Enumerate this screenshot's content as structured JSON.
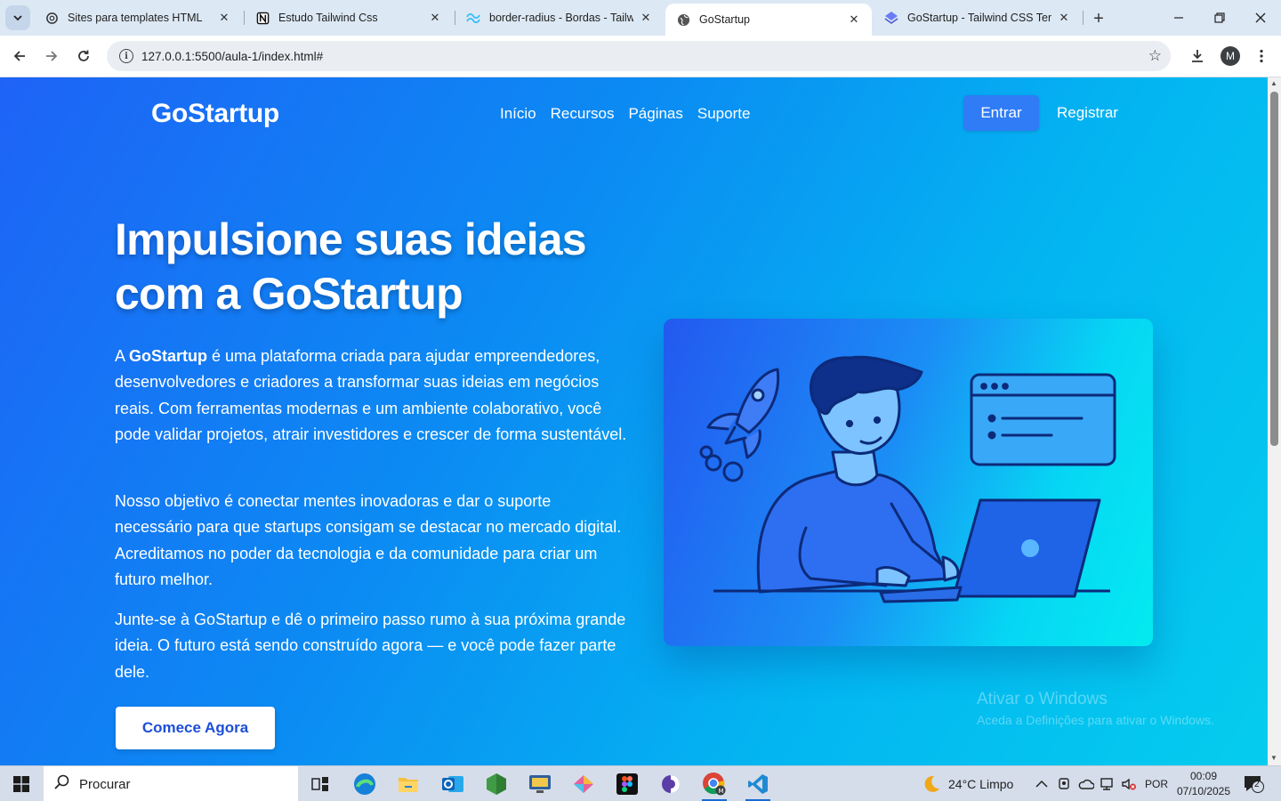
{
  "browser": {
    "tabs": [
      {
        "title": "Sites para templates HTML",
        "icon": "openai-icon",
        "active": false
      },
      {
        "title": "Estudo Tailwind Css",
        "icon": "notion-icon",
        "active": false
      },
      {
        "title": "border-radius - Bordas - Tailwind",
        "icon": "tailwind-icon",
        "active": false
      },
      {
        "title": "GoStartup",
        "icon": "globe-icon",
        "active": true
      },
      {
        "title": "GoStartup - Tailwind CSS Template",
        "icon": "layers-icon",
        "active": false
      }
    ],
    "url": "127.0.0.1:5500/aula-1/index.html#",
    "profile_initial": "M"
  },
  "page": {
    "logo": "GoStartup",
    "nav": [
      "Início",
      "Recursos",
      "Páginas",
      "Suporte"
    ],
    "login_label": "Entrar",
    "register_label": "Registrar",
    "hero_title": "Impulsione suas ideias com a GoStartup",
    "p1_before": "A ",
    "p1_brand": "GoStartup",
    "p1_after": " é uma plataforma criada para ajudar empreendedores, desenvolvedores e criadores a transformar suas ideias em negócios reais. Com ferramentas modernas e um ambiente colaborativo, você pode validar projetos, atrair investidores e crescer de forma sustentável.",
    "p2": "Nosso objetivo é conectar mentes inovadoras e dar o suporte necessário para que startups consigam se destacar no mercado digital. Acreditamos no poder da tecnologia e da comunidade para criar um futuro melhor.",
    "p3": "Junte-se à GoStartup e dê o primeiro passo rumo à sua próxima grande ideia. O futuro está sendo construído agora — e você pode fazer parte dele.",
    "cta_label": "Comece Agora"
  },
  "watermark": {
    "line1": "Ativar o Windows",
    "line2": "Aceda a Definições para ativar o Windows."
  },
  "taskbar": {
    "search_placeholder": "Procurar",
    "weather": "24°C  Limpo",
    "language": "POR",
    "time": "00:09",
    "date": "07/10/2025",
    "notifications": "2"
  },
  "colors": {
    "hero_gradient_start": "#1e63f6",
    "hero_gradient_end": "#05cdee",
    "login_button": "#2f7cf6",
    "cta_text": "#1d4fd8"
  }
}
